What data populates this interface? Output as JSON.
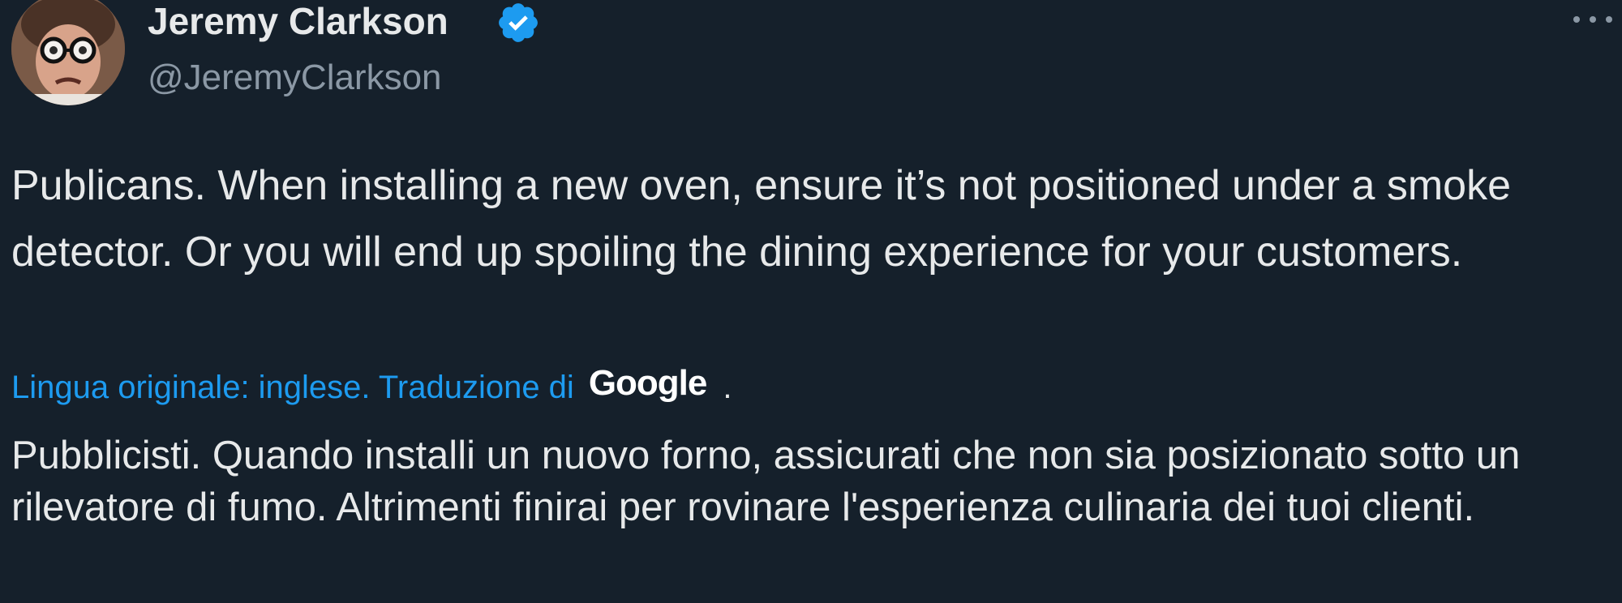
{
  "author": {
    "name": "Jeremy Clarkson",
    "handle": "@JeremyClarkson",
    "verified": true
  },
  "tweet": {
    "text": "Publicans. When installing a new oven, ensure it’s not positioned under a smoke detector. Or you will end up spoiling the dining experience for your customers."
  },
  "translation": {
    "label": "Lingua originale: inglese. Traduzione di",
    "provider": "Google",
    "trailing": ".",
    "text": "Pubblicisti. Quando installi un nuovo forno, assicurati che non sia posizionato sotto un rilevatore di fumo. Altrimenti finirai per rovinare l'esperienza culinaria dei tuoi clienti."
  },
  "icons": {
    "verified": "verified-badge-icon",
    "more": "more-options-icon"
  },
  "colors": {
    "background": "#15202b",
    "text": "#e7e9ea",
    "secondary_text": "#8b98a5",
    "link": "#1d9bf0",
    "verified": "#1d9bf0"
  }
}
